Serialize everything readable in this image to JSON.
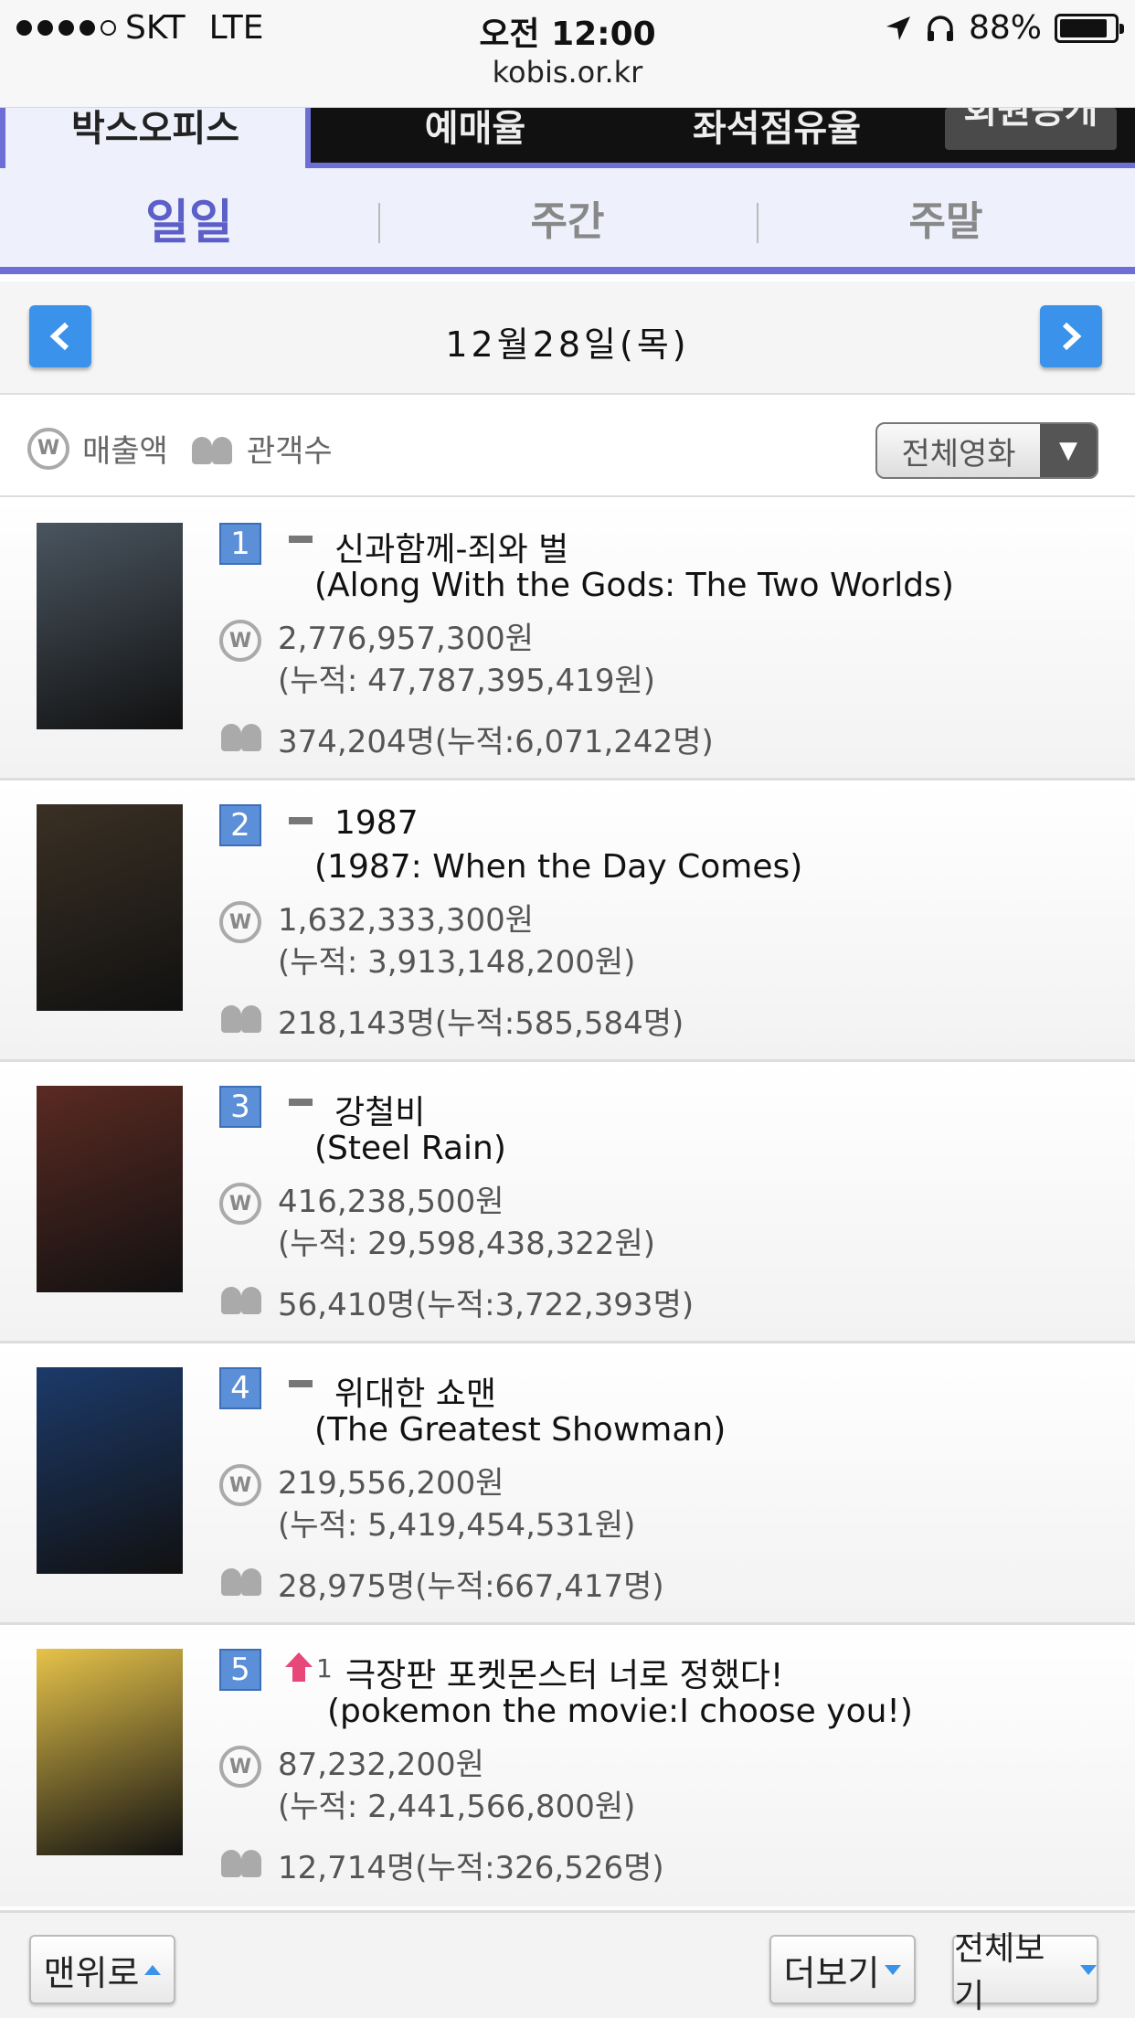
{
  "status": {
    "carrier": "SKT",
    "network": "LTE",
    "time": "오전 12:00",
    "url": "kobis.or.kr",
    "battery": "88%",
    "battery_level": 0.88,
    "signal_bars": 4
  },
  "top_nav": {
    "tabs": [
      "박스오피스",
      "예매율",
      "좌석점유율",
      "회원공개"
    ]
  },
  "sub_tabs": [
    "일일",
    "주간",
    "주말"
  ],
  "date": {
    "prev_label": "<",
    "text": "12월28일(목)",
    "next_label": ">"
  },
  "filter": {
    "sales_label": "매출액",
    "audience_label": "관객수",
    "select_value": "전체영화"
  },
  "movies": [
    {
      "rank": "1",
      "change": "",
      "title_ko": "신과함께-죄와 벌",
      "title_en": "(Along With the Gods: The Two Worlds)",
      "sales": "2,776,957,300원",
      "sales_total": "(누적: 47,787,395,419원)",
      "audience": "374,204명(누적:6,071,242명)",
      "poster_color": "#4a5560"
    },
    {
      "rank": "2",
      "change": "",
      "title_ko": "1987",
      "title_en": "(1987: When the Day Comes)",
      "sales": "1,632,333,300원",
      "sales_total": "(누적: 3,913,148,200원)",
      "audience": "218,143명(누적:585,584명)",
      "poster_color": "#3a3024"
    },
    {
      "rank": "3",
      "change": "",
      "title_ko": "강철비",
      "title_en": "(Steel Rain)",
      "sales": "416,238,500원",
      "sales_total": "(누적: 29,598,438,322원)",
      "audience": "56,410명(누적:3,722,393명)",
      "poster_color": "#5a2a22"
    },
    {
      "rank": "4",
      "change": "",
      "title_ko": "위대한 쇼맨",
      "title_en": "(The Greatest Showman)",
      "sales": "219,556,200원",
      "sales_total": "(누적: 5,419,454,531원)",
      "audience": "28,975명(누적:667,417명)",
      "poster_color": "#1c3a6a"
    },
    {
      "rank": "5",
      "change": "1",
      "title_ko": "극장판 포켓몬스터 너로 정했다!",
      "title_en": "(pokemon the movie:I choose you!)",
      "sales": "87,232,200원",
      "sales_total": "(누적: 2,441,566,800원)",
      "audience": "12,714명(누적:326,526명)",
      "poster_color": "#e6c34a"
    }
  ],
  "footer": {
    "top_label": "맨위로",
    "more_label": "더보기",
    "all_label": "전체보기"
  }
}
